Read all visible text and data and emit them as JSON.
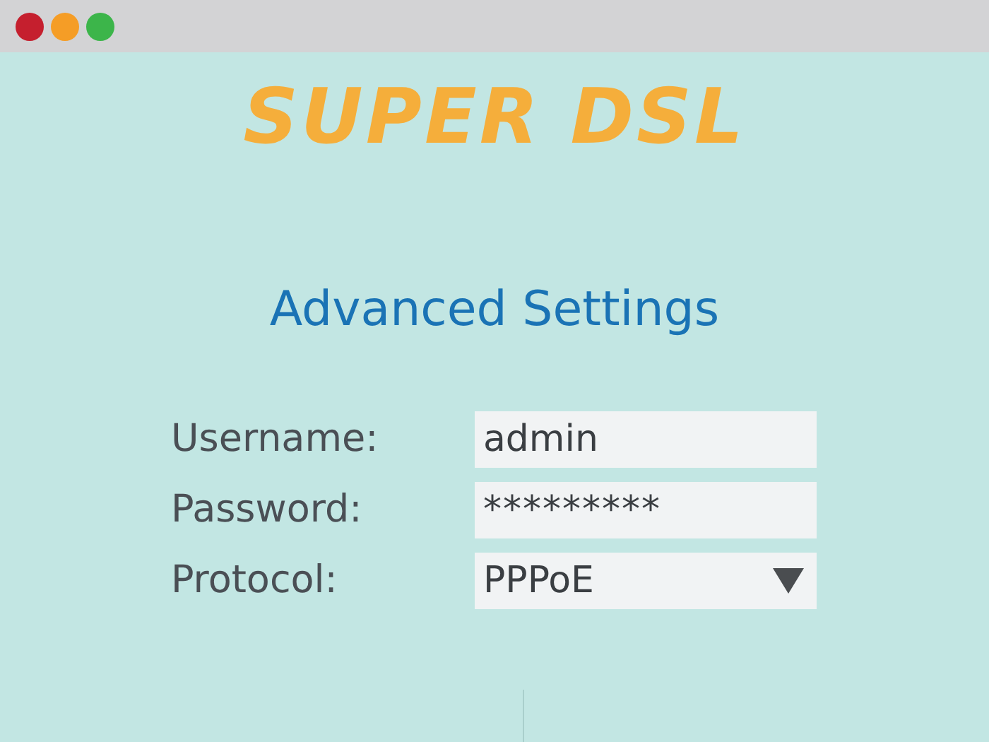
{
  "logo": "SUPER DSL",
  "heading": "Advanced Settings",
  "fields": [
    {
      "label": "Username:",
      "kind": "text",
      "value": "admin"
    },
    {
      "label": "Password:",
      "kind": "password",
      "value": "*********"
    },
    {
      "label": "Protocol:",
      "kind": "select",
      "value": "PPPoE"
    }
  ]
}
